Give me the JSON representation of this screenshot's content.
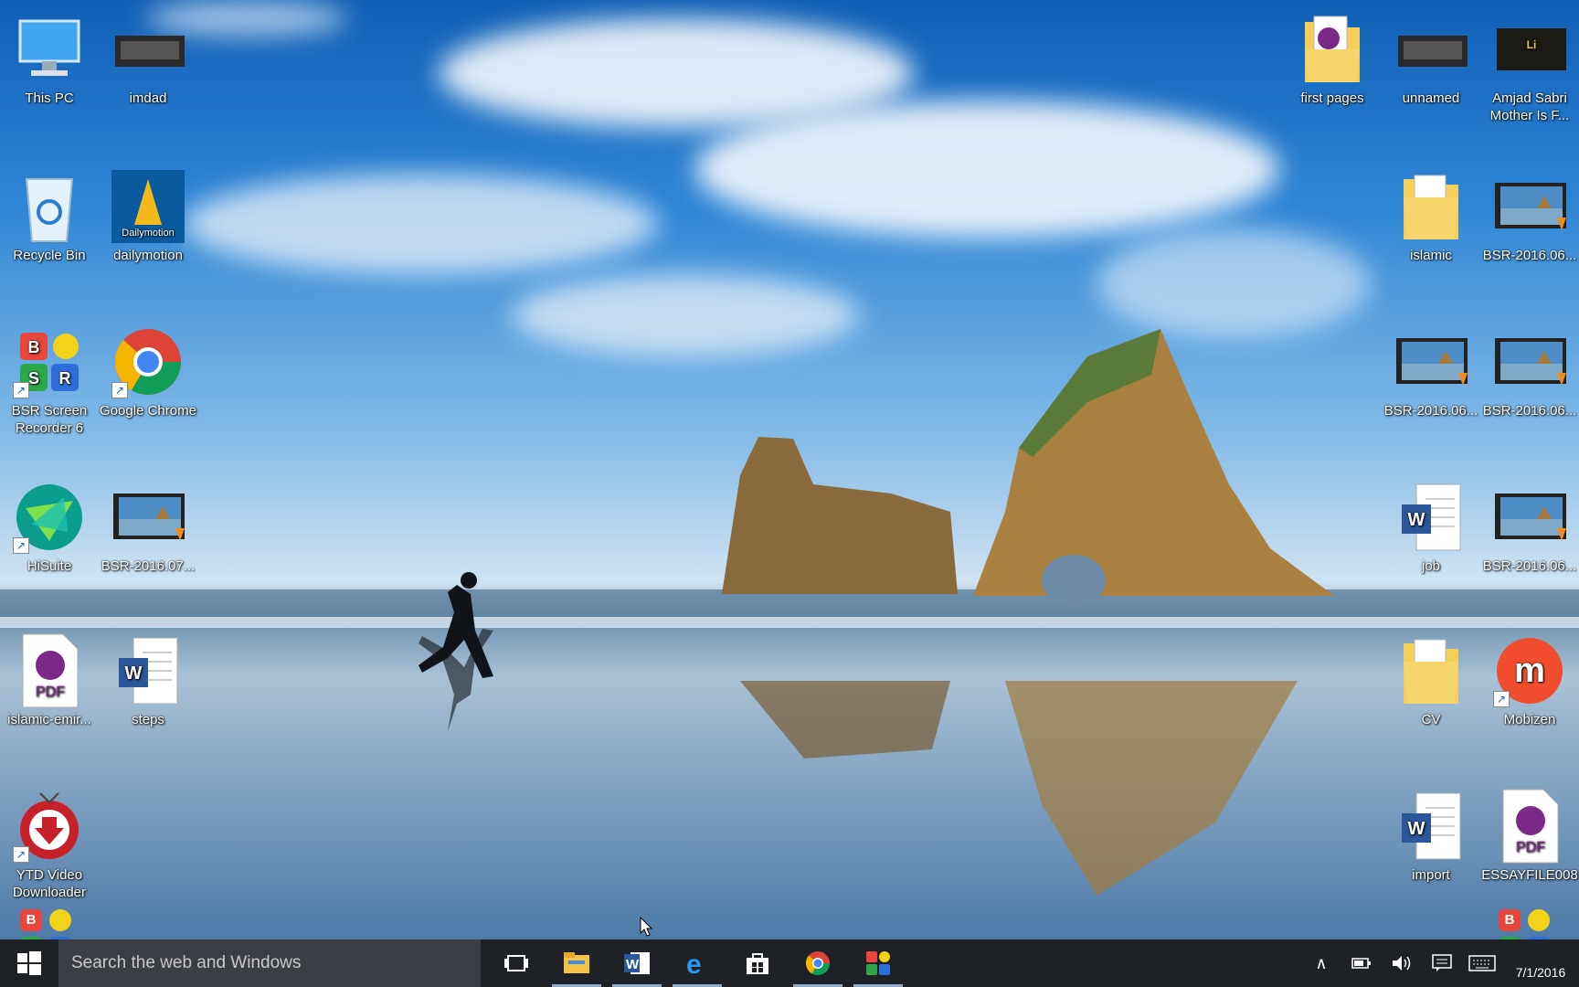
{
  "desktop": {
    "left_icons": [
      {
        "label": "This PC",
        "icon": "monitor-icon"
      },
      {
        "label": "imdad",
        "icon": "image-thumbnail-icon"
      },
      {
        "label": "Recycle Bin",
        "icon": "recycle-bin-icon"
      },
      {
        "label": "dailymotion",
        "icon": "dailymotion-icon"
      },
      {
        "label": "BSR Screen Recorder 6",
        "icon": "bsr-icon"
      },
      {
        "label": "Google Chrome",
        "icon": "chrome-icon"
      },
      {
        "label": "HiSuite",
        "icon": "hisuite-icon"
      },
      {
        "label": "BSR-2016.07...",
        "icon": "video-file-icon"
      },
      {
        "label": "islamic-emir...",
        "icon": "pdf-icon"
      },
      {
        "label": "steps",
        "icon": "word-doc-icon"
      },
      {
        "label": "YTD Video Downloader",
        "icon": "ytd-icon"
      }
    ],
    "right_icons": [
      {
        "label": "first pages",
        "icon": "folder-pdf-icon"
      },
      {
        "label": "unnamed",
        "icon": "image-thumbnail-icon"
      },
      {
        "label": "Amjad Sabri Mother Is F...",
        "icon": "video-thumbnail-icon"
      },
      {
        "label": "islamic",
        "icon": "folder-icon"
      },
      {
        "label": "BSR-2016.06...",
        "icon": "video-file-icon"
      },
      {
        "label": "BSR-2016.06...",
        "icon": "video-file-icon"
      },
      {
        "label": "BSR-2016.06...",
        "icon": "video-file-icon"
      },
      {
        "label": "job",
        "icon": "word-doc-icon"
      },
      {
        "label": "BSR-2016.06...",
        "icon": "video-file-icon"
      },
      {
        "label": "CV",
        "icon": "folder-icon"
      },
      {
        "label": "Mobizen",
        "icon": "mobizen-icon"
      },
      {
        "label": "import",
        "icon": "word-doc-icon"
      },
      {
        "label": "ESSAYFILE008",
        "icon": "pdf-icon"
      }
    ]
  },
  "icon_text": {
    "pdf": "PDF",
    "word": "W",
    "bsr_b": "B",
    "bsr_s": "S",
    "bsr_r": "R",
    "dailymotion": "Dailymotion",
    "mobizen": "m"
  },
  "taskbar": {
    "search_placeholder": "Search the web and Windows",
    "apps": [
      "task-view-icon",
      "file-explorer-icon",
      "word-icon",
      "edge-icon",
      "store-icon",
      "chrome-icon",
      "bsr-icon"
    ],
    "clock_date": "7/1/2016"
  },
  "colors": {
    "taskbar": "#1e2126",
    "search_box": "#3b3f45",
    "accent": "#1a5fb4"
  }
}
